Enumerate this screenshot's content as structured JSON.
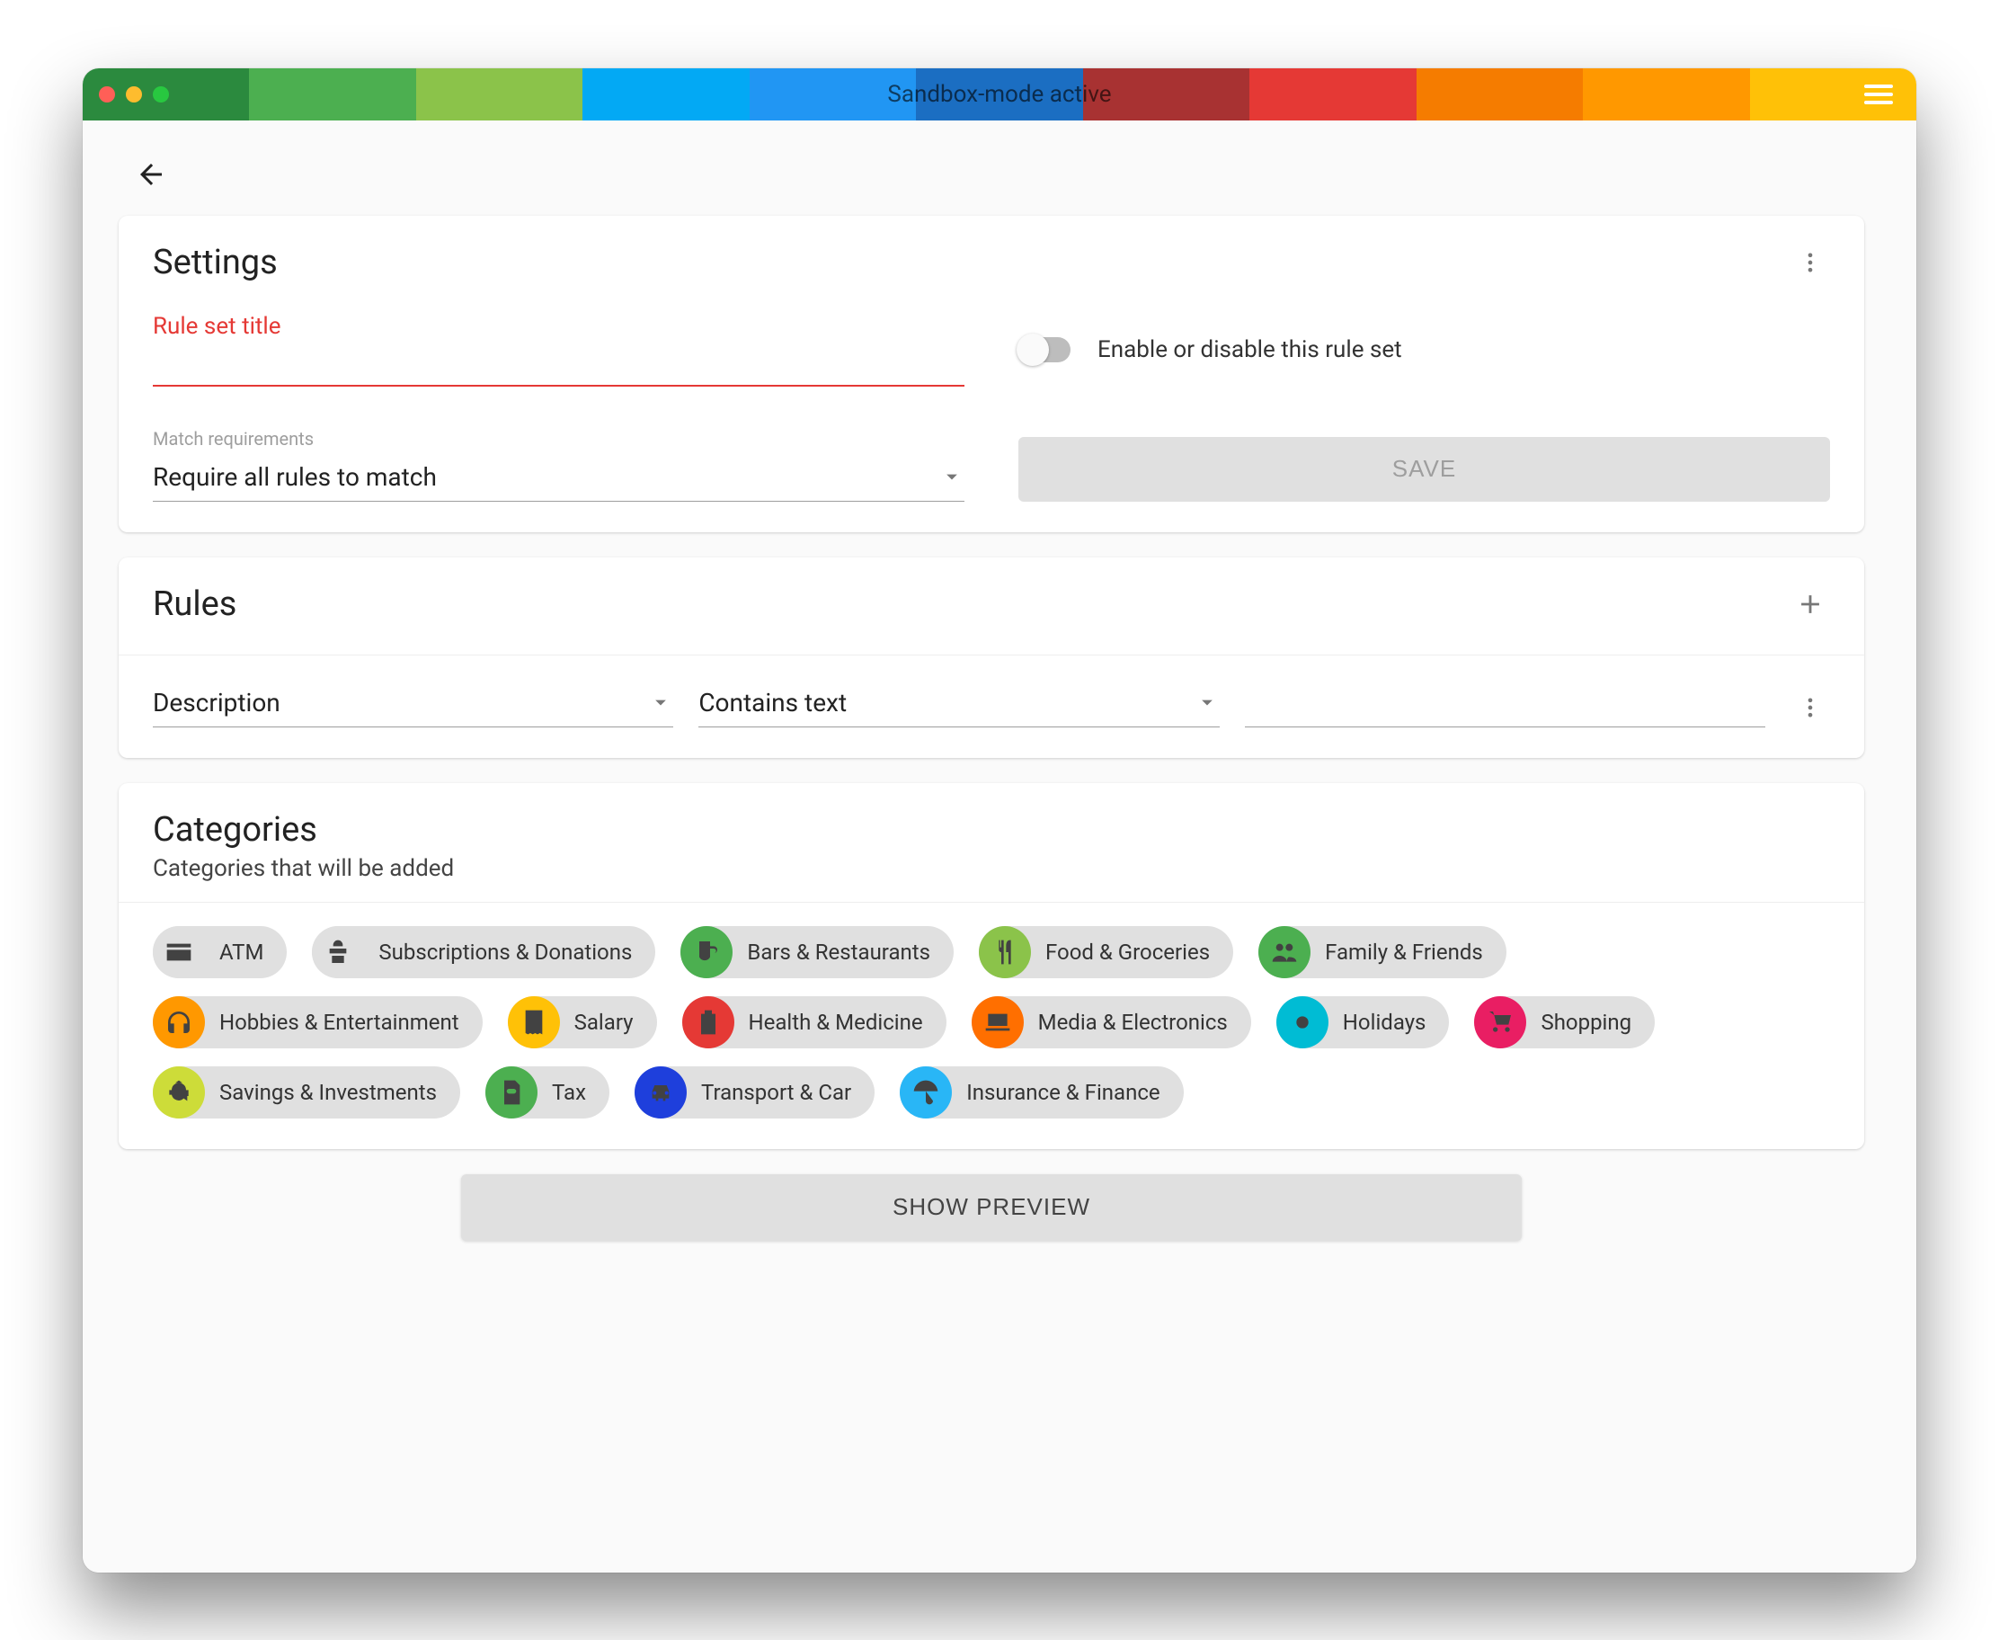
{
  "window": {
    "title": "Sandbox-mode active"
  },
  "header_colors": [
    "#2b8a3e",
    "#4caf50",
    "#8bc34a",
    "#03a9f4",
    "#2196f3",
    "#1b6ec2",
    "#a83232",
    "#e53935",
    "#f57c00",
    "#ff9800",
    "#ffc107"
  ],
  "cards": {
    "settings": {
      "title": "Settings",
      "rule_title_label": "Rule set title",
      "rule_title_value": "",
      "match_req_label": "Match requirements",
      "match_req_value": "Require all rules to match",
      "toggle_label": "Enable or disable this rule set",
      "save_label": "SAVE"
    },
    "rules": {
      "title": "Rules",
      "row": {
        "field_sel": "Description",
        "op_sel": "Contains text",
        "value": ""
      }
    },
    "categories": {
      "title": "Categories",
      "subtitle": "Categories that will be added",
      "items": [
        {
          "label": "ATM",
          "color": "#e0e0e0",
          "icon": "credit-card"
        },
        {
          "label": "Subscriptions & Donations",
          "color": "#e0e0e0",
          "icon": "donate"
        },
        {
          "label": "Bars & Restaurants",
          "color": "#4caf50",
          "icon": "beer"
        },
        {
          "label": "Food & Groceries",
          "color": "#8bc34a",
          "icon": "utensils"
        },
        {
          "label": "Family & Friends",
          "color": "#4caf50",
          "icon": "users"
        },
        {
          "label": "Hobbies & Entertainment",
          "color": "#ff9800",
          "icon": "headphones"
        },
        {
          "label": "Salary",
          "color": "#ffc107",
          "icon": "receipt"
        },
        {
          "label": "Health & Medicine",
          "color": "#e53935",
          "icon": "clipboard"
        },
        {
          "label": "Media & Electronics",
          "color": "#ff6f00",
          "icon": "laptop"
        },
        {
          "label": "Holidays",
          "color": "#00bcd4",
          "icon": "sun"
        },
        {
          "label": "Shopping",
          "color": "#e91e63",
          "icon": "cart"
        },
        {
          "label": "Savings & Investments",
          "color": "#cddc39",
          "icon": "piggy"
        },
        {
          "label": "Tax",
          "color": "#4caf50",
          "icon": "file-dollar"
        },
        {
          "label": "Transport & Car",
          "color": "#1e3fdc",
          "icon": "car"
        },
        {
          "label": "Insurance & Finance",
          "color": "#29b6f6",
          "icon": "umbrella"
        }
      ]
    }
  },
  "preview_label": "SHOW PREVIEW"
}
